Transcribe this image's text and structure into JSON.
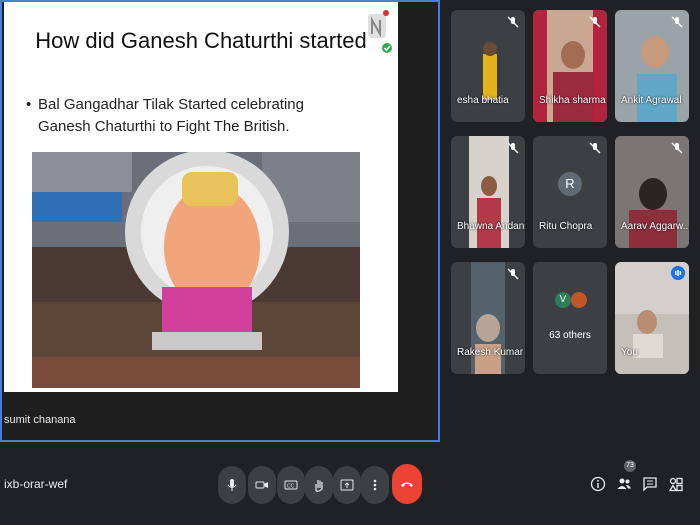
{
  "slide": {
    "title": "How did Ganesh Chaturthi started",
    "bullet": "Bal Gangadhar Tilak Started celebrating  Ganesh Chaturthi to Fight The British."
  },
  "presenter": {
    "name": "sumit chanana"
  },
  "participants": [
    {
      "name": "esha bhatia",
      "muted": true
    },
    {
      "name": "Shikha sharma",
      "muted": true
    },
    {
      "name": "Ankit Agrawal",
      "muted": true
    },
    {
      "name": "Bhawna Andani",
      "muted": true
    },
    {
      "name": "Ritu Chopra",
      "initial": "R",
      "muted": true
    },
    {
      "name": "Aarav Aggarw...",
      "muted": true
    },
    {
      "name": "Rakesh Kumar",
      "muted": true
    },
    {
      "name": "You",
      "speaking": true
    }
  ],
  "others": {
    "initial": "V",
    "label": "63 others"
  },
  "meeting": {
    "code": "ixb-orar-wef",
    "participant_count": "73"
  },
  "controls": [
    "mic-icon",
    "camera-icon",
    "captions-icon",
    "raise-hand-icon",
    "present-icon",
    "more-options-icon",
    "leave-call-icon"
  ],
  "colors": {
    "accent": "#1a73e8",
    "leave": "#ea4335",
    "background": "#202124"
  }
}
